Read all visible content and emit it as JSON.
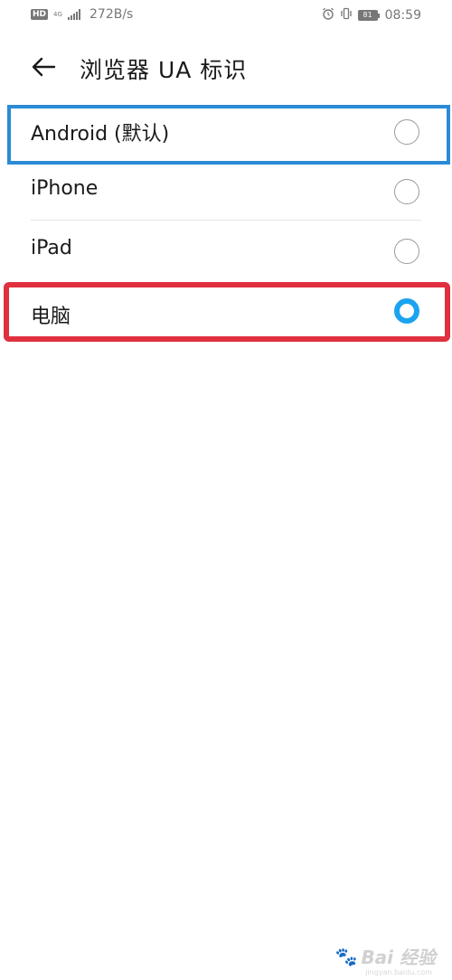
{
  "status_bar": {
    "hd": "HD",
    "network": "4G",
    "speed": "272B/s",
    "battery": "81",
    "time": "08:59"
  },
  "header": {
    "title": "浏览器 UA 标识"
  },
  "options": [
    {
      "label": "Android (默认)",
      "selected": false
    },
    {
      "label": "iPhone",
      "selected": false
    },
    {
      "label": "iPad",
      "selected": false
    },
    {
      "label": "电脑",
      "selected": true
    }
  ],
  "colors": {
    "accent": "#1aa3f0",
    "highlight_blue": "#2a8bd7",
    "highlight_red": "#e03040"
  },
  "watermark": {
    "text": "Bai 经验",
    "url": "jingyan.baidu.com"
  }
}
